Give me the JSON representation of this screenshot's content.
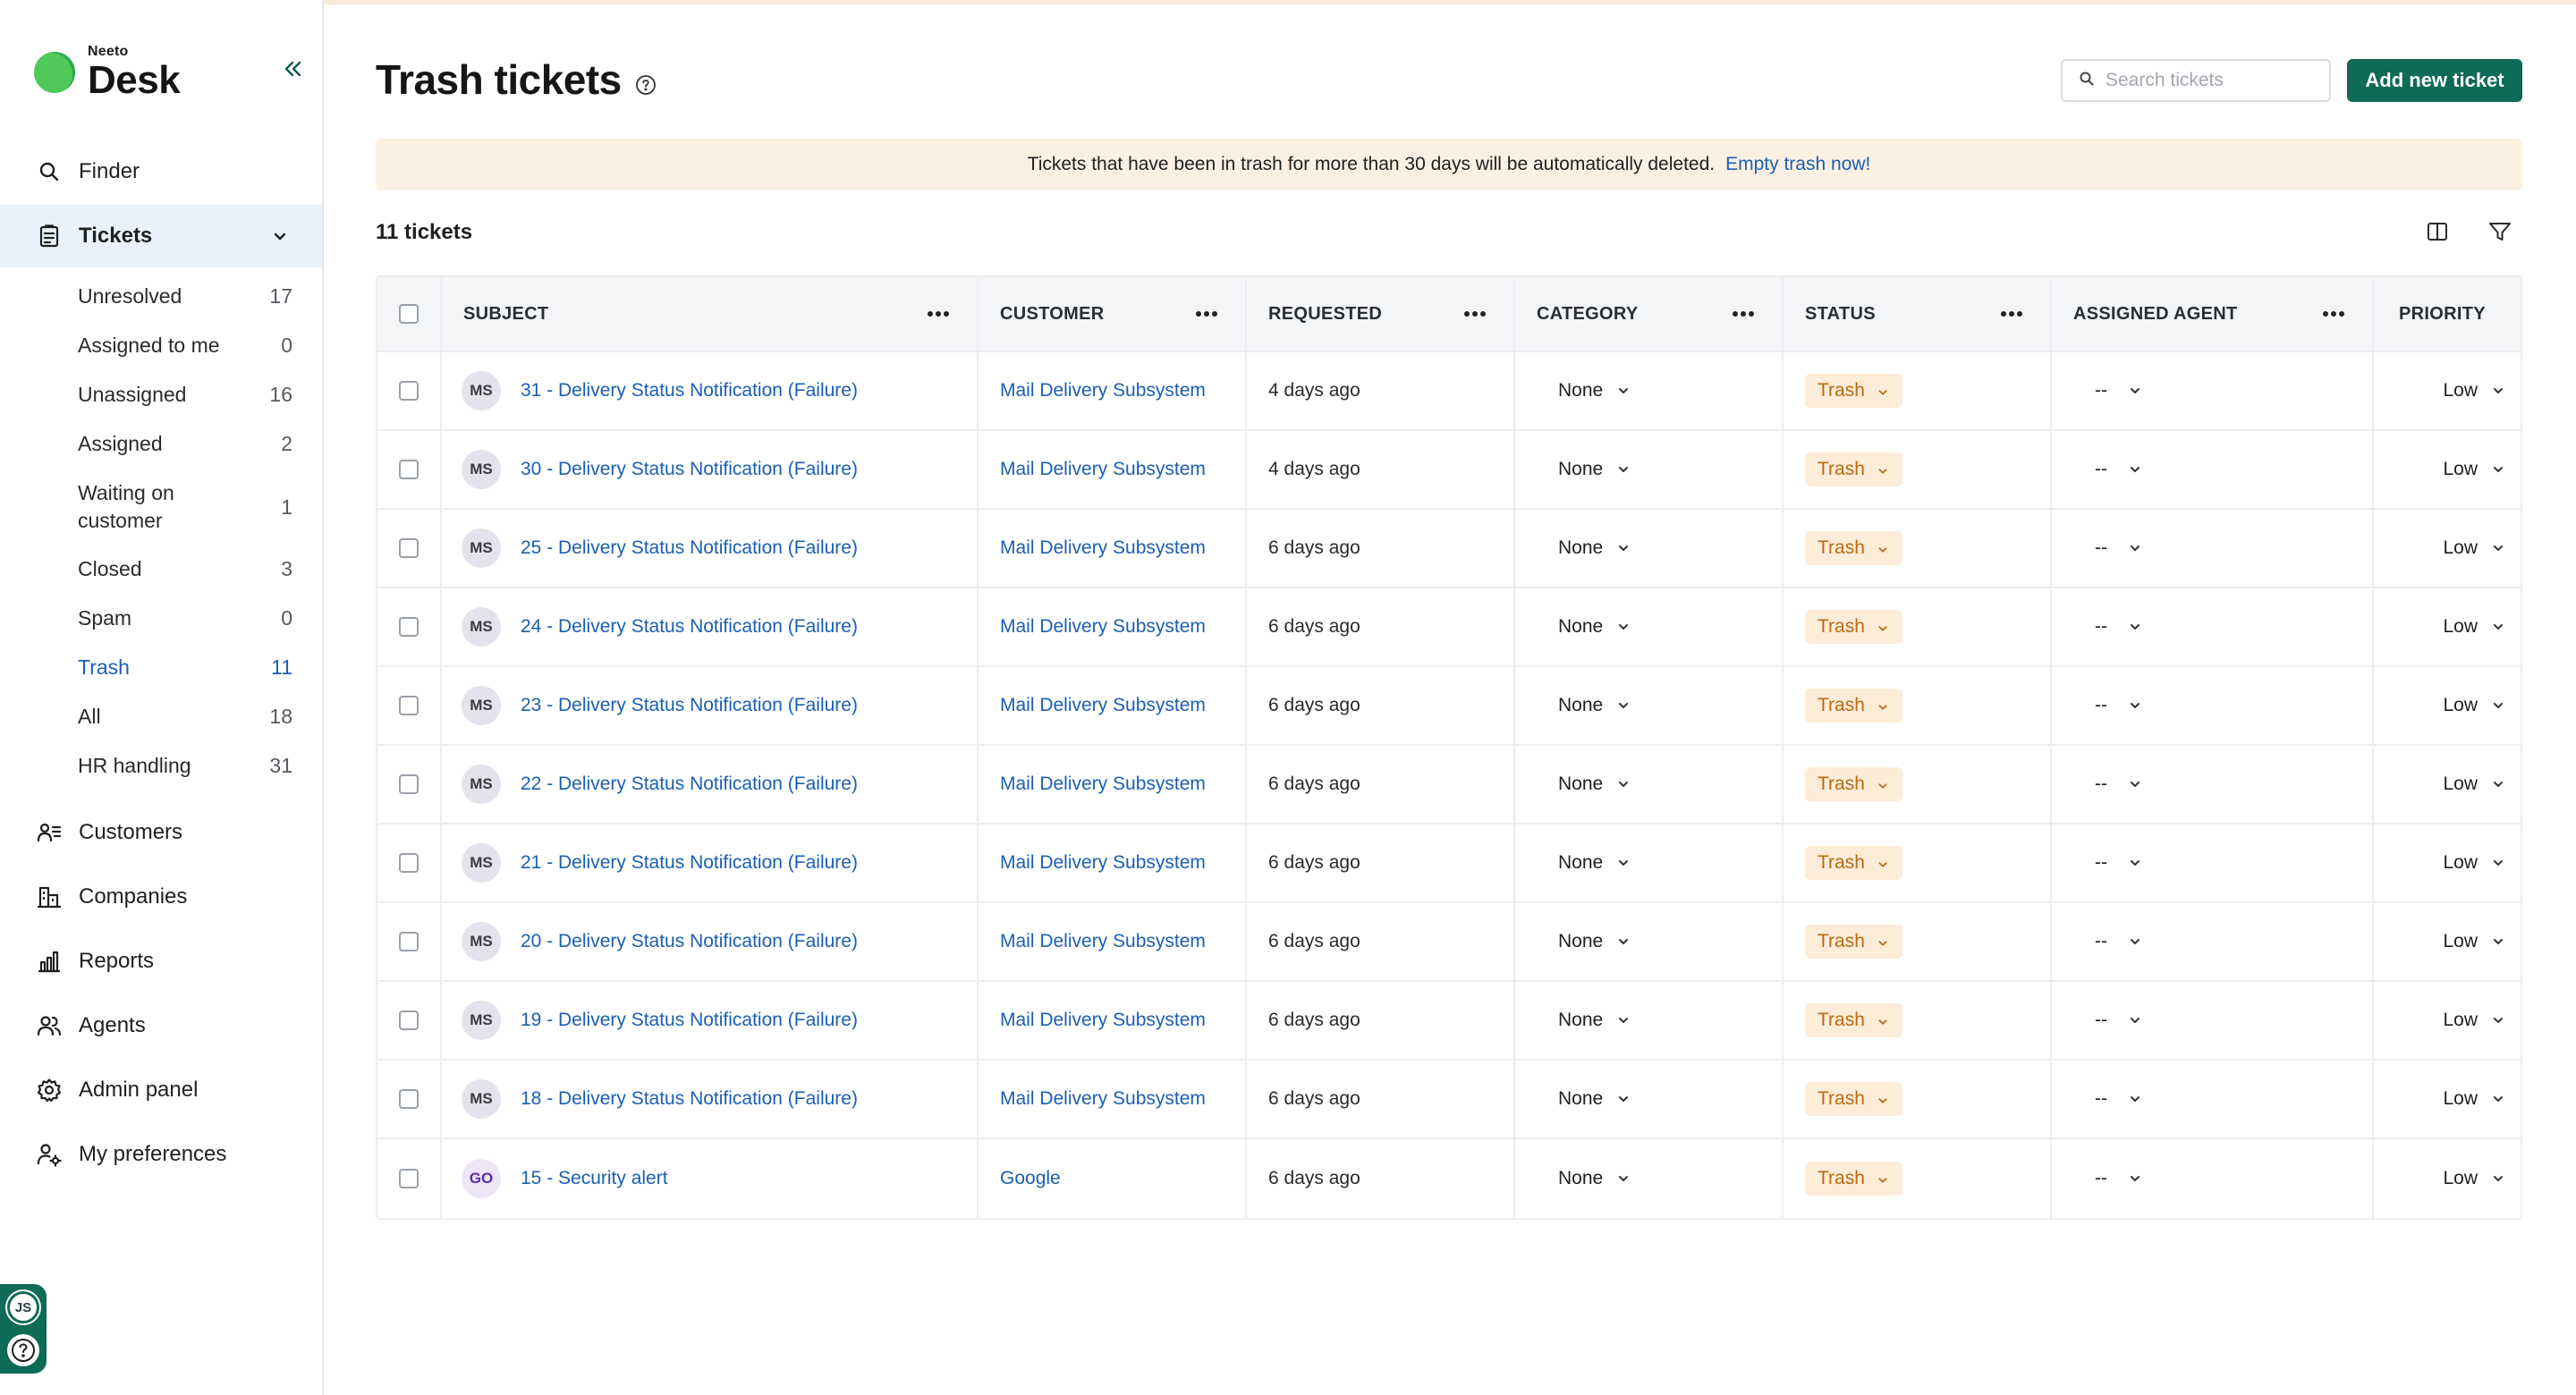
{
  "app": {
    "logo_small": "Neeto",
    "logo_big": "Desk"
  },
  "sidebar": {
    "nav_top": [
      {
        "label": "Finder",
        "icon": "search-icon"
      },
      {
        "label": "Tickets",
        "icon": "tickets-icon"
      }
    ],
    "ticket_views": [
      {
        "label": "Unresolved",
        "count": "17"
      },
      {
        "label": "Assigned to me",
        "count": "0"
      },
      {
        "label": "Unassigned",
        "count": "16"
      },
      {
        "label": "Assigned",
        "count": "2"
      },
      {
        "label": "Waiting on customer",
        "count": "1"
      },
      {
        "label": "Closed",
        "count": "3"
      },
      {
        "label": "Spam",
        "count": "0"
      },
      {
        "label": "Trash",
        "count": "11"
      },
      {
        "label": "All",
        "count": "18"
      },
      {
        "label": "HR handling",
        "count": "31"
      }
    ],
    "nav_bottom": [
      {
        "label": "Customers",
        "icon": "customers-icon"
      },
      {
        "label": "Companies",
        "icon": "companies-icon"
      },
      {
        "label": "Reports",
        "icon": "reports-icon"
      },
      {
        "label": "Agents",
        "icon": "agents-icon"
      },
      {
        "label": "Admin panel",
        "icon": "gear-icon"
      },
      {
        "label": "My preferences",
        "icon": "user-settings-icon"
      }
    ],
    "user_initials": "JS"
  },
  "header": {
    "title": "Trash tickets",
    "search_placeholder": "Search tickets",
    "add_button": "Add new ticket"
  },
  "banner": {
    "text": "Tickets that have been in trash for more than 30 days will be automatically deleted.",
    "link": "Empty trash now!"
  },
  "ticket_count": "11 tickets",
  "table": {
    "columns": [
      "Subject",
      "Customer",
      "Requested",
      "Category",
      "Status",
      "Assigned agent",
      "Priority"
    ],
    "rows": [
      {
        "initials": "MS",
        "subject": "31 - Delivery Status Notification (Failure)",
        "customer": "Mail Delivery Subsystem",
        "requested": "4 days ago",
        "category": "None",
        "status": "Trash",
        "agent": "--",
        "priority": "Low"
      },
      {
        "initials": "MS",
        "subject": "30 - Delivery Status Notification (Failure)",
        "customer": "Mail Delivery Subsystem",
        "requested": "4 days ago",
        "category": "None",
        "status": "Trash",
        "agent": "--",
        "priority": "Low"
      },
      {
        "initials": "MS",
        "subject": "25 - Delivery Status Notification (Failure)",
        "customer": "Mail Delivery Subsystem",
        "requested": "6 days ago",
        "category": "None",
        "status": "Trash",
        "agent": "--",
        "priority": "Low"
      },
      {
        "initials": "MS",
        "subject": "24 - Delivery Status Notification (Failure)",
        "customer": "Mail Delivery Subsystem",
        "requested": "6 days ago",
        "category": "None",
        "status": "Trash",
        "agent": "--",
        "priority": "Low"
      },
      {
        "initials": "MS",
        "subject": "23 - Delivery Status Notification (Failure)",
        "customer": "Mail Delivery Subsystem",
        "requested": "6 days ago",
        "category": "None",
        "status": "Trash",
        "agent": "--",
        "priority": "Low"
      },
      {
        "initials": "MS",
        "subject": "22 - Delivery Status Notification (Failure)",
        "customer": "Mail Delivery Subsystem",
        "requested": "6 days ago",
        "category": "None",
        "status": "Trash",
        "agent": "--",
        "priority": "Low"
      },
      {
        "initials": "MS",
        "subject": "21 - Delivery Status Notification (Failure)",
        "customer": "Mail Delivery Subsystem",
        "requested": "6 days ago",
        "category": "None",
        "status": "Trash",
        "agent": "--",
        "priority": "Low"
      },
      {
        "initials": "MS",
        "subject": "20 - Delivery Status Notification (Failure)",
        "customer": "Mail Delivery Subsystem",
        "requested": "6 days ago",
        "category": "None",
        "status": "Trash",
        "agent": "--",
        "priority": "Low"
      },
      {
        "initials": "MS",
        "subject": "19 - Delivery Status Notification (Failure)",
        "customer": "Mail Delivery Subsystem",
        "requested": "6 days ago",
        "category": "None",
        "status": "Trash",
        "agent": "--",
        "priority": "Low"
      },
      {
        "initials": "MS",
        "subject": "18 - Delivery Status Notification (Failure)",
        "customer": "Mail Delivery Subsystem",
        "requested": "6 days ago",
        "category": "None",
        "status": "Trash",
        "agent": "--",
        "priority": "Low"
      },
      {
        "initials": "GO",
        "subject": "15 - Security alert",
        "customer": "Google",
        "requested": "6 days ago",
        "category": "None",
        "status": "Trash",
        "agent": "--",
        "priority": "Low"
      }
    ]
  },
  "colors": {
    "brand_green": "#0e6b55",
    "link_blue": "#1a5fb4",
    "trash_pill_bg": "#fdecd7",
    "trash_pill_text": "#b86a12",
    "banner_bg": "#fbf0e2"
  }
}
